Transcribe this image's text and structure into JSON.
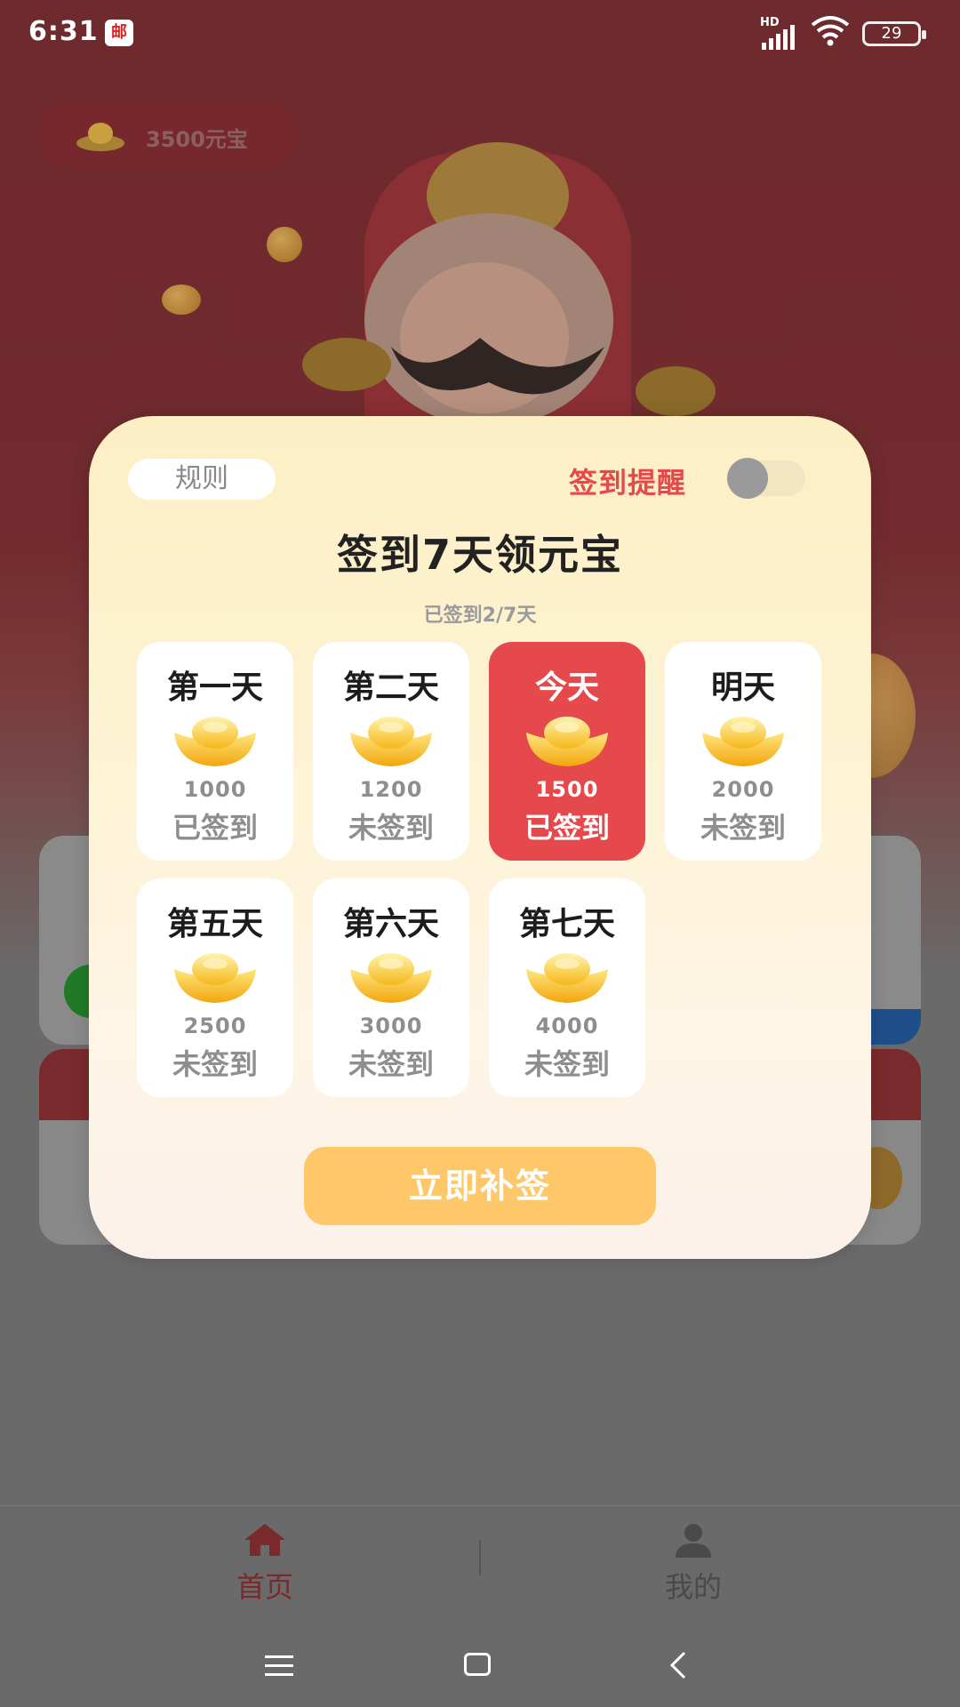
{
  "status_bar": {
    "time": "6:31",
    "app_badge": "邮",
    "network": "HD",
    "battery": "29"
  },
  "balance": {
    "text": "3500元宝"
  },
  "modal": {
    "rules_label": "规则",
    "reminder_label": "签到提醒",
    "reminder_on": false,
    "title": "签到7天领元宝",
    "progress": "已签到2/7天",
    "days": [
      {
        "label": "第一天",
        "amount": "1000",
        "status": "已签到",
        "today": false
      },
      {
        "label": "第二天",
        "amount": "1200",
        "status": "未签到",
        "today": false
      },
      {
        "label": "今天",
        "amount": "1500",
        "status": "已签到",
        "today": true
      },
      {
        "label": "明天",
        "amount": "2000",
        "status": "未签到",
        "today": false
      },
      {
        "label": "第五天",
        "amount": "2500",
        "status": "未签到",
        "today": false
      },
      {
        "label": "第六天",
        "amount": "3000",
        "status": "未签到",
        "today": false
      },
      {
        "label": "第七天",
        "amount": "4000",
        "status": "未签到",
        "today": false
      }
    ],
    "makeup_button": "立即补签"
  },
  "tab_bar": {
    "home_label": "首页",
    "mine_label": "我的"
  },
  "colors": {
    "accent_red": "#e5494b",
    "button_gold": "#fdc76a",
    "modal_bg": "#fdf3d4"
  }
}
